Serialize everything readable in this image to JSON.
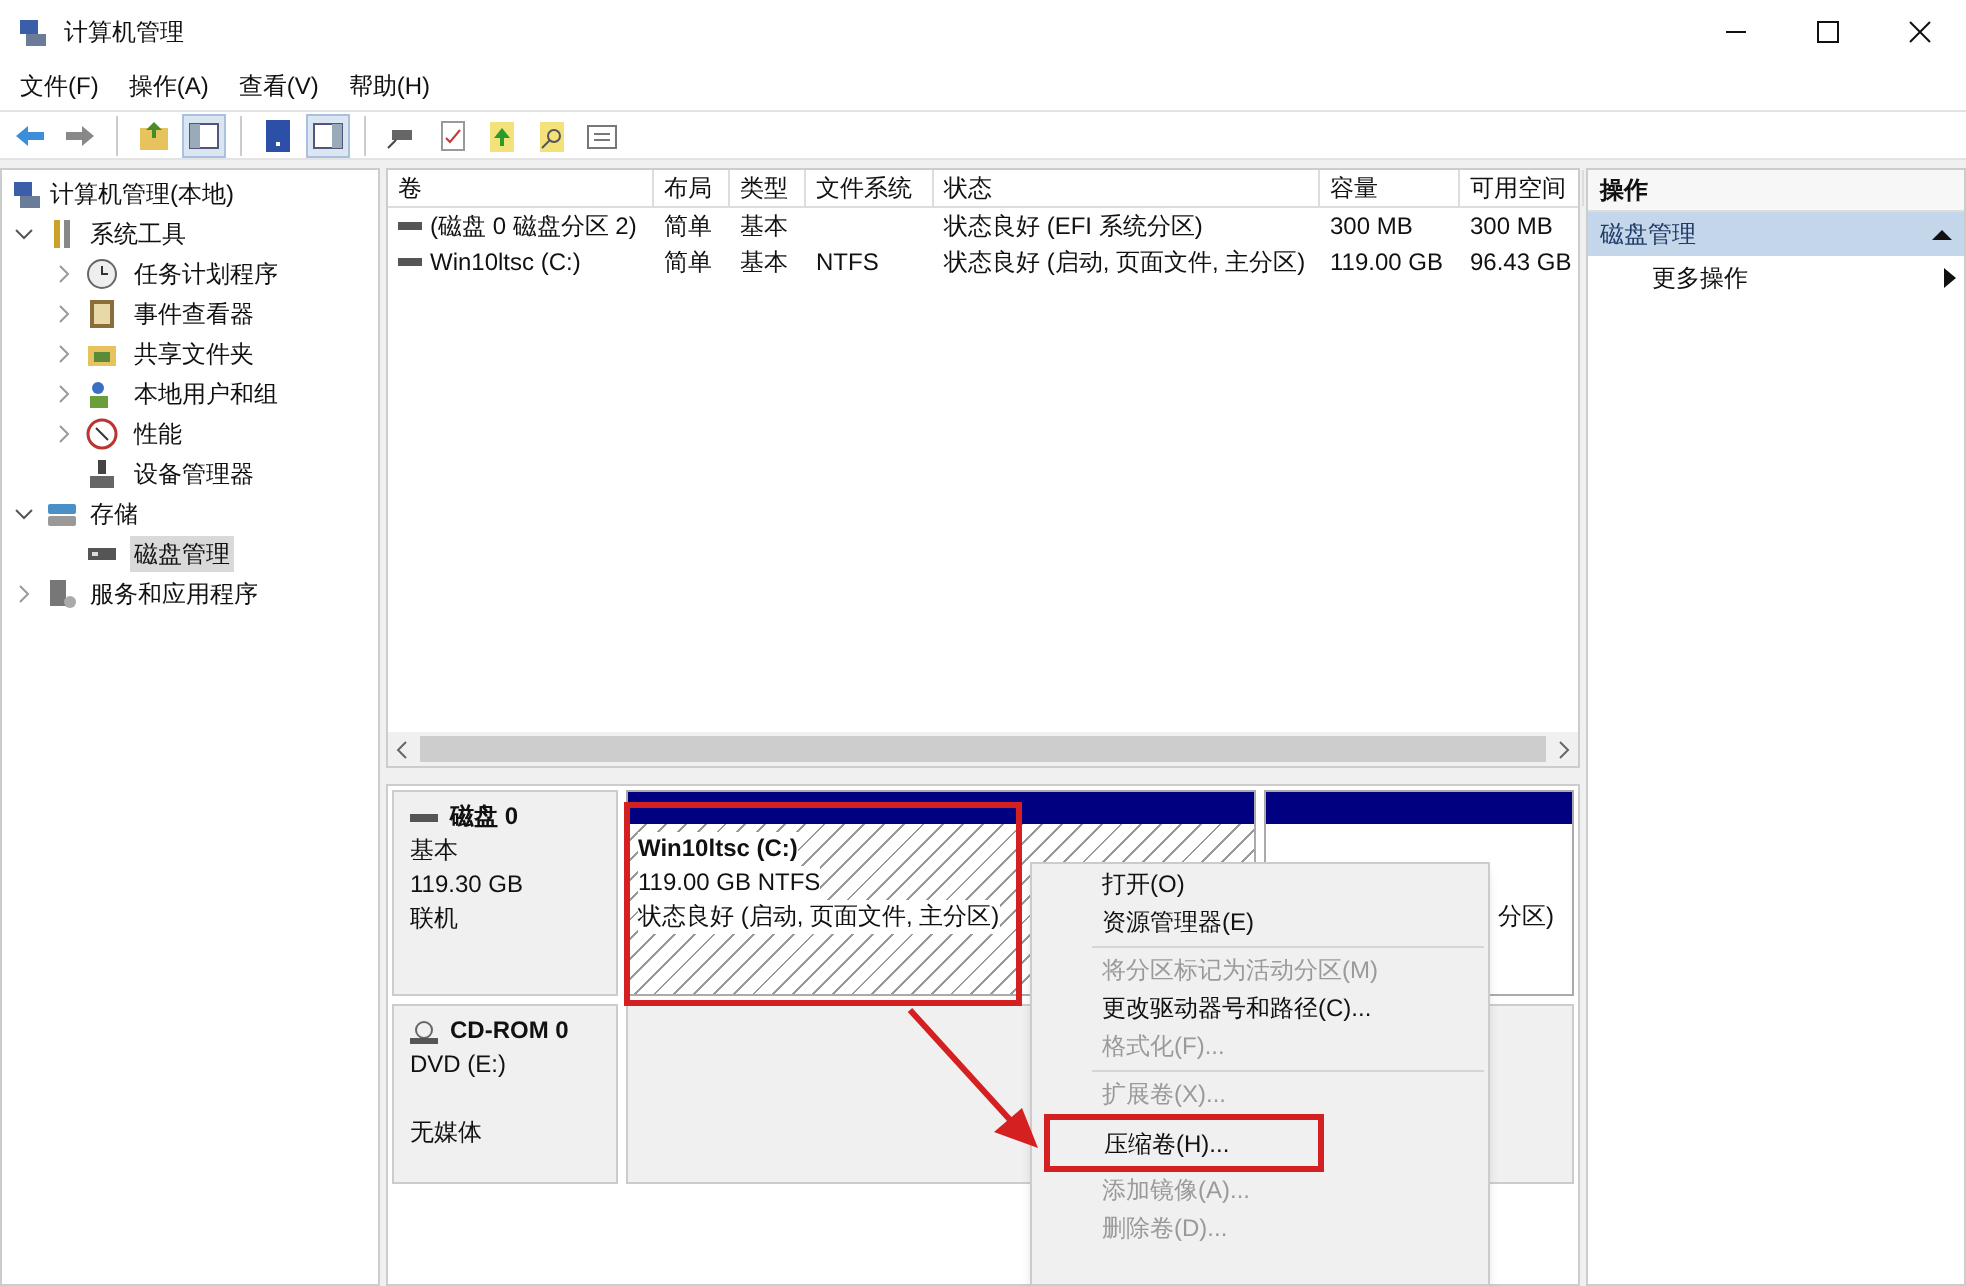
{
  "window": {
    "title": "计算机管理"
  },
  "menu": [
    "文件(F)",
    "操作(A)",
    "查看(V)",
    "帮助(H)"
  ],
  "toolbar": [
    {
      "kind": "back"
    },
    {
      "kind": "forward"
    },
    {
      "kind": "sep"
    },
    {
      "kind": "up"
    },
    {
      "kind": "panel",
      "selected": true
    },
    {
      "kind": "sep"
    },
    {
      "kind": "help"
    },
    {
      "kind": "panel2",
      "selected": true
    },
    {
      "kind": "sep"
    },
    {
      "kind": "connect"
    },
    {
      "kind": "check"
    },
    {
      "kind": "upload"
    },
    {
      "kind": "find"
    },
    {
      "kind": "list"
    }
  ],
  "tree": [
    {
      "label": "计算机管理(本地)",
      "kind": "computer",
      "children": [
        {
          "label": "系统工具",
          "kind": "tools",
          "expanded": true,
          "children": [
            {
              "label": "任务计划程序",
              "kind": "clock",
              "expanded": false,
              "selected": false
            },
            {
              "label": "事件查看器",
              "kind": "log",
              "expanded": false,
              "selected": false
            },
            {
              "label": "共享文件夹",
              "kind": "folder",
              "expanded": false,
              "selected": false
            },
            {
              "label": "本地用户和组",
              "kind": "users",
              "expanded": false,
              "selected": false
            },
            {
              "label": "性能",
              "kind": "gauge",
              "expanded": false,
              "selected": false
            },
            {
              "label": "设备管理器",
              "kind": "device",
              "selected": false
            }
          ]
        },
        {
          "label": "存储",
          "kind": "storage",
          "expanded": true,
          "children": [
            {
              "label": "磁盘管理",
              "kind": "disk",
              "selected": true
            }
          ]
        },
        {
          "label": "服务和应用程序",
          "kind": "services",
          "expanded": false
        }
      ]
    }
  ],
  "table": {
    "columns": [
      "卷",
      "布局",
      "类型",
      "文件系统",
      "状态",
      "容量",
      "可用空间"
    ],
    "rows": [
      [
        "(磁盘 0 磁盘分区 2)",
        "简单",
        "基本",
        "",
        "状态良好 (EFI 系统分区)",
        "300 MB",
        "300 MB"
      ],
      [
        "Win10ltsc (C:)",
        "简单",
        "基本",
        "NTFS",
        "状态良好 (启动, 页面文件, 主分区)",
        "119.00 GB",
        "96.43 GB"
      ]
    ]
  },
  "disks": [
    {
      "name": "磁盘 0",
      "kind": "disk",
      "lines": [
        "基本",
        "119.30 GB",
        "联机"
      ],
      "partitions": [
        {
          "name": "Win10ltsc  (C:)",
          "size": "119.00 GB NTFS",
          "status": "状态良好 (启动, 页面文件, 主分区)",
          "hatched": true
        },
        {
          "status": "分区)",
          "hatched": false
        }
      ]
    },
    {
      "name": "CD-ROM 0",
      "kind": "cdrom",
      "lines": [
        "DVD (E:)",
        "无媒体"
      ]
    }
  ],
  "actions": {
    "title": "操作",
    "section": "磁盘管理",
    "items": [
      "更多操作"
    ]
  },
  "context_menu": [
    {
      "label": "打开(O)",
      "disabled": false
    },
    {
      "label": "资源管理器(E)",
      "disabled": false
    },
    {
      "kind": "sep"
    },
    {
      "label": "将分区标记为活动分区(M)",
      "disabled": true
    },
    {
      "label": "更改驱动器号和路径(C)...",
      "disabled": false
    },
    {
      "label": "格式化(F)...",
      "disabled": true
    },
    {
      "kind": "sep"
    },
    {
      "label": "扩展卷(X)...",
      "disabled": true
    },
    {
      "label": "压缩卷(H)...",
      "disabled": false,
      "highlighted": true
    },
    {
      "label": "添加镜像(A)...",
      "disabled": true
    },
    {
      "label": "删除卷(D)...",
      "disabled": true
    }
  ]
}
